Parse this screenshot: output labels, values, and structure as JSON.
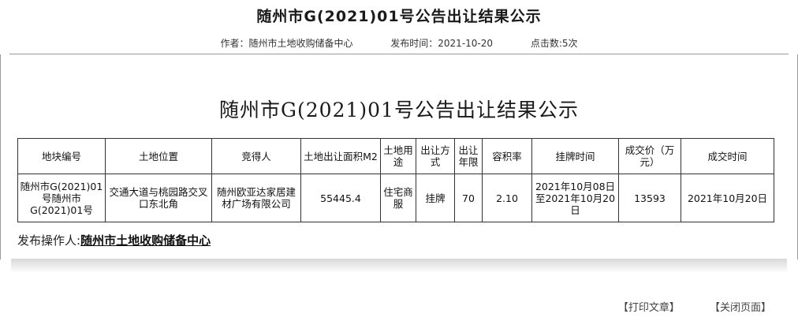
{
  "page": {
    "title": "随州市G(2021)01号公告出让结果公示",
    "author": "作者：随州市土地收购储备中心",
    "publish_time": "发布时间：2021-10-20",
    "hits": "点击数:5次"
  },
  "article": {
    "title": "随州市G(2021)01号公告出让结果公示",
    "table": {
      "headers": [
        "地块编号",
        "土地位置",
        "竞得人",
        "土地出让面积M2",
        "土地用途",
        "出让方式",
        "出让年限",
        "容积率",
        "挂牌时间",
        "成交价（万元）",
        "成交时间"
      ],
      "rows": [
        [
          "随州市G(2021)01号随州市G(2021)01号",
          "交通大道与桃园路交叉口东北角",
          "随州欧亚达家居建材广场有限公司",
          "55445.4",
          "住宅商服",
          "挂牌",
          "70",
          "2.10",
          "2021年10月08日至2021年10月20日",
          "13593",
          "2021年10月20日"
        ]
      ]
    },
    "publisher_label": "发布操作人:",
    "publisher_name": "随州市土地收购储备中心"
  },
  "footer": {
    "print": "【打印文章】",
    "close": "【关闭页面】"
  }
}
